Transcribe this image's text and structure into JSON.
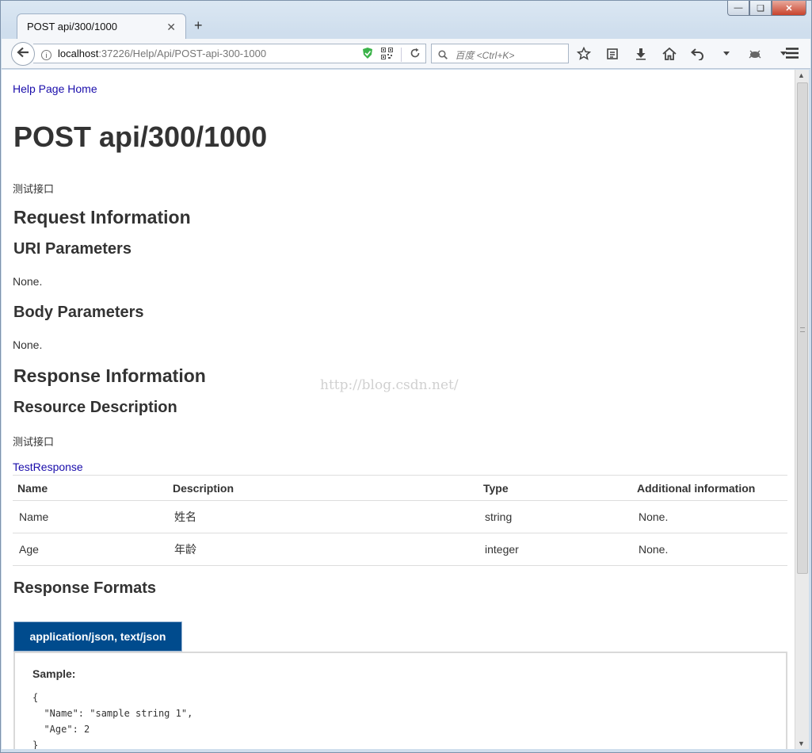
{
  "browser": {
    "tab_title": "POST api/300/1000",
    "url_host": "localhost",
    "url_path": ":37226/Help/Api/POST-api-300-1000",
    "search_placeholder": "百度 <Ctrl+K>"
  },
  "page": {
    "home_link": "Help Page Home",
    "title": "POST api/300/1000",
    "description": "测试接口",
    "request_heading": "Request Information",
    "uri_params_heading": "URI Parameters",
    "uri_params_value": "None.",
    "body_params_heading": "Body Parameters",
    "body_params_value": "None.",
    "response_heading": "Response Information",
    "resource_desc_heading": "Resource Description",
    "resource_desc_text": "测试接口",
    "response_type_link": "TestResponse",
    "table": {
      "headers": [
        "Name",
        "Description",
        "Type",
        "Additional information"
      ],
      "rows": [
        [
          "Name",
          "姓名",
          "string",
          "None."
        ],
        [
          "Age",
          "年龄",
          "integer",
          "None."
        ]
      ]
    },
    "formats_heading": "Response Formats",
    "format_tab": "application/json, text/json",
    "sample_label": "Sample:",
    "sample_code": "{\n  \"Name\": \"sample string 1\",\n  \"Age\": 2\n}"
  },
  "watermark": "http://blog.csdn.net/"
}
